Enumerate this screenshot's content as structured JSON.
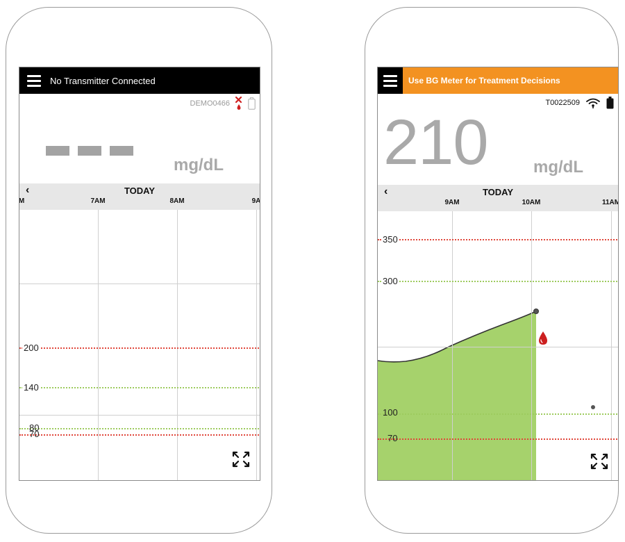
{
  "left_phone": {
    "banner_text": "No Transmitter Connected",
    "transmitter_id": "DEMO0466",
    "glucose_value": "---",
    "units": "mg/dL",
    "day_label": "TODAY",
    "time_labels": [
      "M",
      "7AM",
      "8AM",
      "9A"
    ],
    "thresholds": {
      "high_alert": "200",
      "target_high": "140",
      "target_low": "80",
      "low_alert": "70"
    }
  },
  "right_phone": {
    "banner_text": "Use BG Meter for Treatment Decisions",
    "transmitter_id": "T0022509",
    "glucose_value": "210",
    "units": "mg/dL",
    "day_label": "TODAY",
    "time_labels": [
      "9AM",
      "10AM",
      "11AM"
    ],
    "thresholds": {
      "urgent_high": "350",
      "high_alert": "300",
      "target_low": "100",
      "low_alert": "70"
    }
  },
  "colors": {
    "banner_left": "#000000",
    "banner_right_accent": "#f39221",
    "glucose_fill": "#a6d26c",
    "high_line": "#e0463a",
    "target_line": "#9dcb5e",
    "blood_drop": "#cc1f1f"
  },
  "icons": [
    "menu-icon",
    "sensor-error-icon",
    "battery-icon",
    "signal-icon",
    "back-chevron-icon",
    "expand-icon",
    "blood-drop-icon"
  ]
}
